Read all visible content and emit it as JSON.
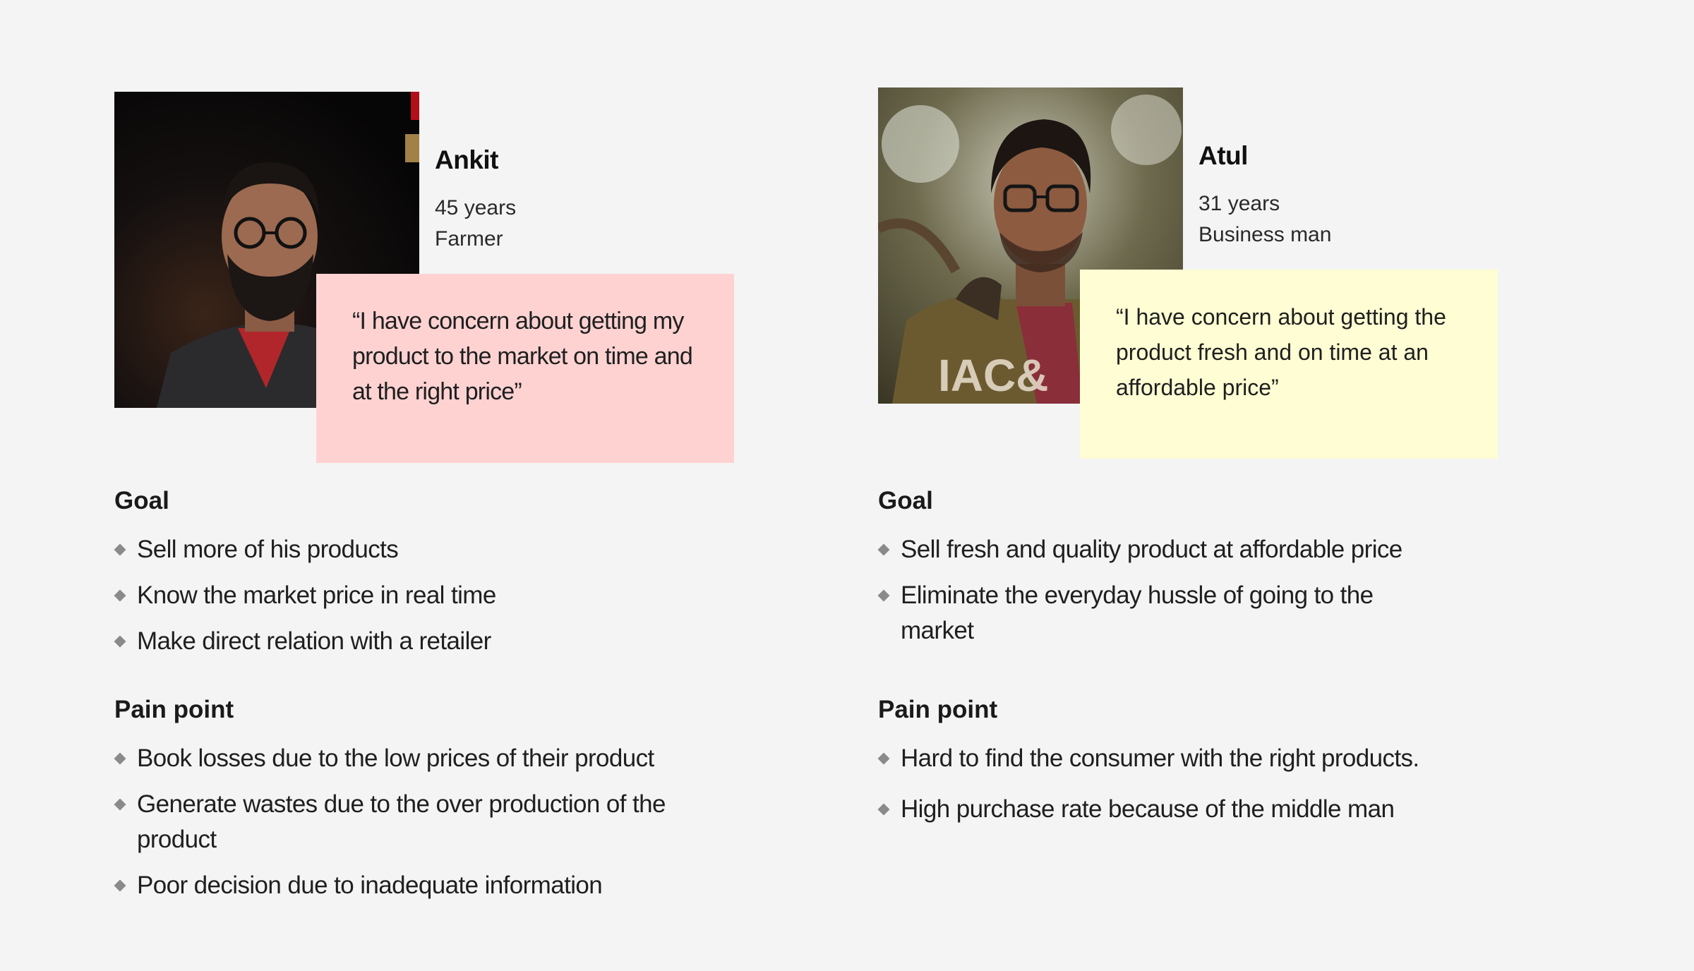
{
  "personas": [
    {
      "name": "Ankit",
      "age": "45 years",
      "occupation": "Farmer",
      "quote": "“I have concern about getting my product to the market on time and at the right price”",
      "quote_color": "#ffd2d2",
      "goal_title": "Goal",
      "goals": [
        "Sell more of his products",
        "Know the market price in real time",
        "Make direct relation with a retailer"
      ],
      "pain_title": "Pain point",
      "pains": [
        "Book losses due to the low prices of their product",
        "Generate wastes due to the over production of the product",
        "Poor decision due to inadequate information"
      ]
    },
    {
      "name": "Atul",
      "age": "31 years",
      "occupation": "Business man",
      "quote": "“I have concern about getting the product fresh and on time at an affordable price”",
      "quote_color": "#fefdd3",
      "goal_title": "Goal",
      "goals": [
        "Sell fresh and quality product at affordable price",
        "Eliminate the everyday hussle of going to the market"
      ],
      "pain_title": "Pain point",
      "pains": [
        "Hard to find the consumer with the right products.",
        "High purchase rate because of the middle man"
      ]
    }
  ]
}
